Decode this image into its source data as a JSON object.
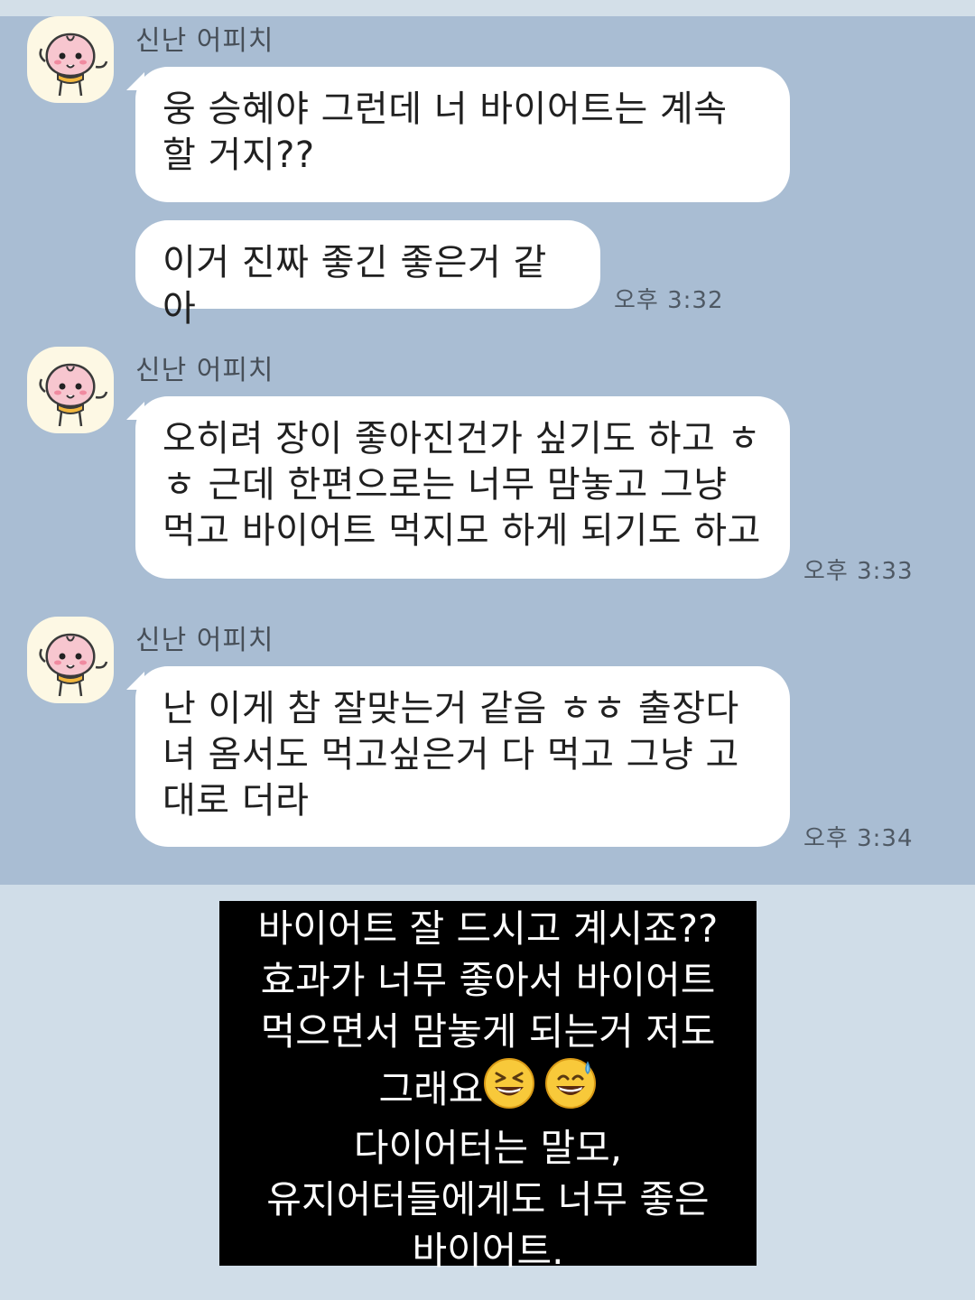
{
  "chat": {
    "sender_name": "신난 어피치",
    "groups": [
      {
        "messages": [
          "웅 승혜야 그런데 너 바이어트는 계속 할 거지??",
          "이거 진짜 좋긴 좋은거 같아"
        ],
        "time": "오후 3:32"
      },
      {
        "messages": [
          "오히려 장이 좋아진건가 싶기도 하고 ㅎ ㅎ 근데 한편으로는 너무 맘놓고 그냥 먹고 바이어트 먹지모 하게 되기도 하고"
        ],
        "time": "오후 3:33"
      },
      {
        "messages": [
          "난 이게 참 잘맞는거 같음 ㅎㅎ 출장다녀 옴서도 먹고싶은거 다 먹고 그냥 고대로 더라"
        ],
        "time": "오후 3:34"
      }
    ]
  },
  "caption": {
    "lines": [
      "바이어트 잘 드시고 계시죠??",
      "효과가 너무 좋아서 바이어트",
      "먹으면서 맘놓게 되는거 저도",
      "그래요",
      "다이어터는 말모,",
      "유지어터들에게도 너무 좋은",
      "바이어트."
    ],
    "emojis": [
      "grinning-squinting-face",
      "grinning-face-with-sweat"
    ]
  },
  "colors": {
    "chat_background": "#a9bdd3",
    "bubble": "#ffffff",
    "caption_background": "#000000",
    "caption_text": "#ffffff",
    "page_background": "#d0dde8"
  }
}
